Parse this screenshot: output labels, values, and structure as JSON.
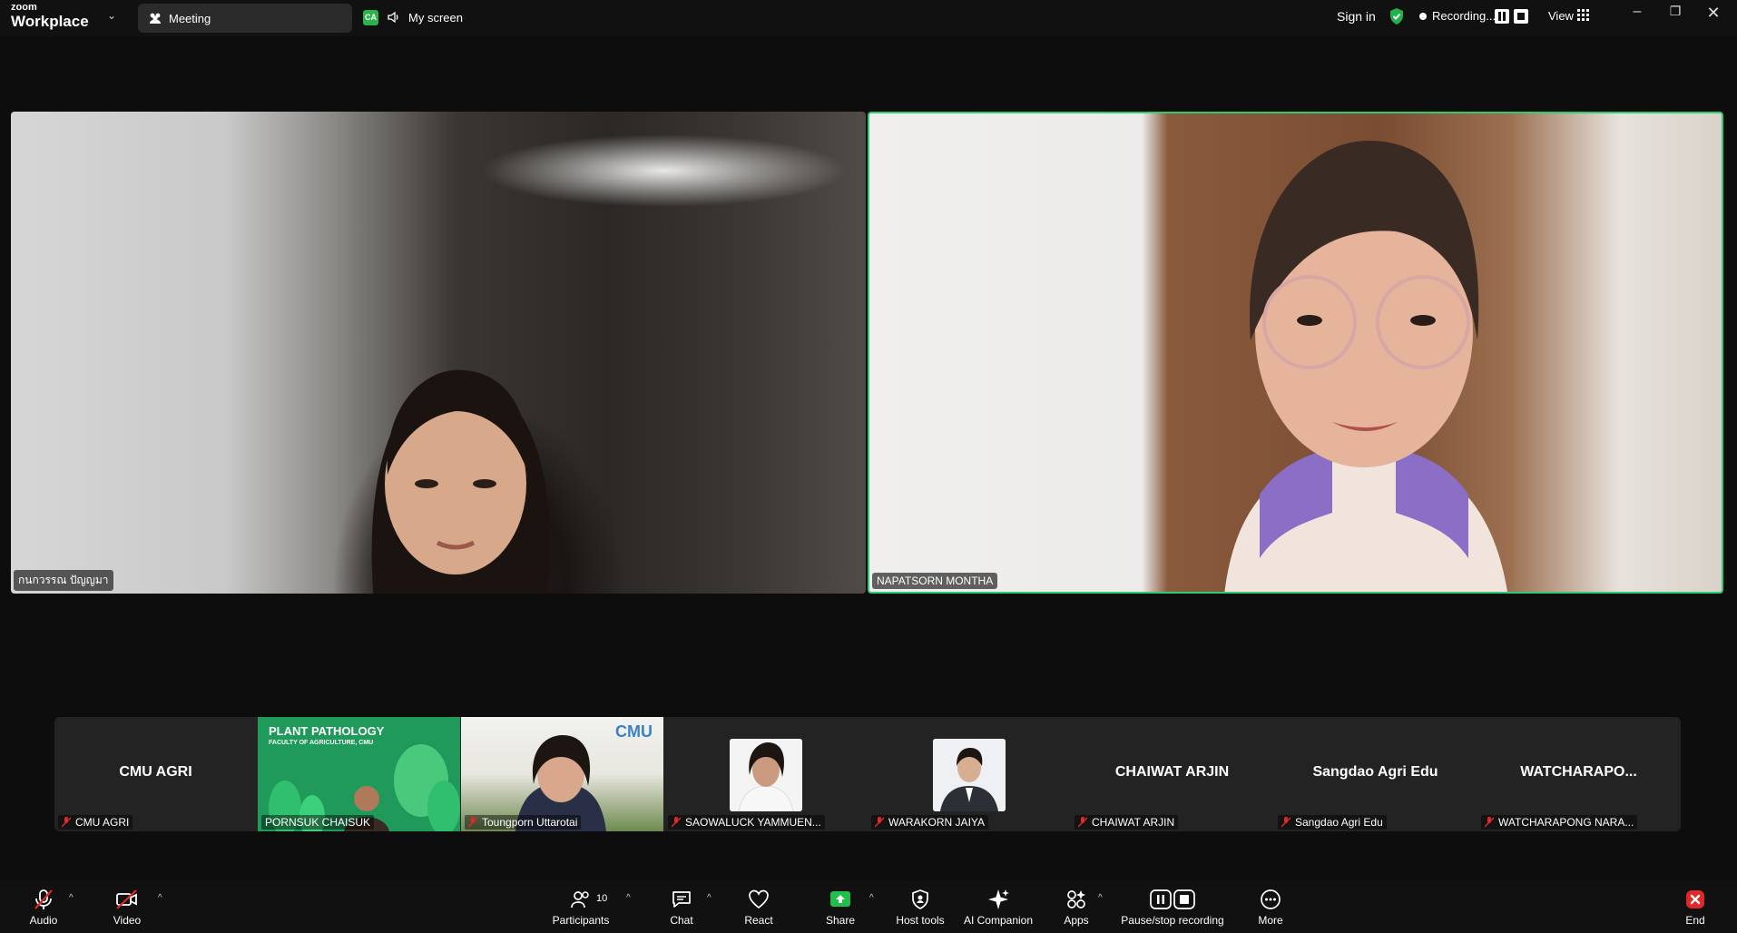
{
  "app": {
    "logo_small": "zoom",
    "logo_big": "Workplace"
  },
  "topbar": {
    "meeting_label": "Meeting",
    "ca_badge": "CA",
    "screen_label": "My screen",
    "sign_in": "Sign in",
    "recording_label": "Recording...",
    "view_label": "View"
  },
  "main_videos": [
    {
      "name": "กนกวรรณ ปัญญมา",
      "active": false
    },
    {
      "name": "NAPATSORN MONTHA",
      "active": true
    }
  ],
  "filmstrip": [
    {
      "display": "CMU AGRI",
      "label": "CMU AGRI",
      "muted": true,
      "type": "name"
    },
    {
      "display": "PLANT PATHOLOGY",
      "subtitle": "FACULTY OF AGRICULTURE, CMU",
      "label": "PORNSUK CHAISUK",
      "muted": false,
      "type": "video"
    },
    {
      "display": "CMU",
      "label": "Toungporn Uttarotai",
      "muted": true,
      "type": "video"
    },
    {
      "display": "",
      "label": "SAOWALUCK YAMMUEN...",
      "muted": true,
      "type": "photo"
    },
    {
      "display": "",
      "label": "WARAKORN JAIYA",
      "muted": true,
      "type": "photo"
    },
    {
      "display": "CHAIWAT ARJIN",
      "label": "CHAIWAT ARJIN",
      "muted": true,
      "type": "name"
    },
    {
      "display": "Sangdao Agri Edu",
      "label": "Sangdao Agri Edu",
      "muted": true,
      "type": "name"
    },
    {
      "display": "WATCHARAPO...",
      "label": "WATCHARAPONG NARA...",
      "muted": true,
      "type": "name"
    }
  ],
  "toolbar": {
    "audio": "Audio",
    "video": "Video",
    "participants": "Participants",
    "participants_count": "10",
    "chat": "Chat",
    "react": "React",
    "share": "Share",
    "host_tools": "Host tools",
    "ai_companion": "AI Companion",
    "apps": "Apps",
    "pause_stop": "Pause/stop recording",
    "more": "More",
    "end": "End"
  },
  "colors": {
    "active_speaker_border": "#2ecc71",
    "share_green": "#1fbf4a",
    "end_red": "#e02828",
    "muted_red": "#e02828"
  }
}
